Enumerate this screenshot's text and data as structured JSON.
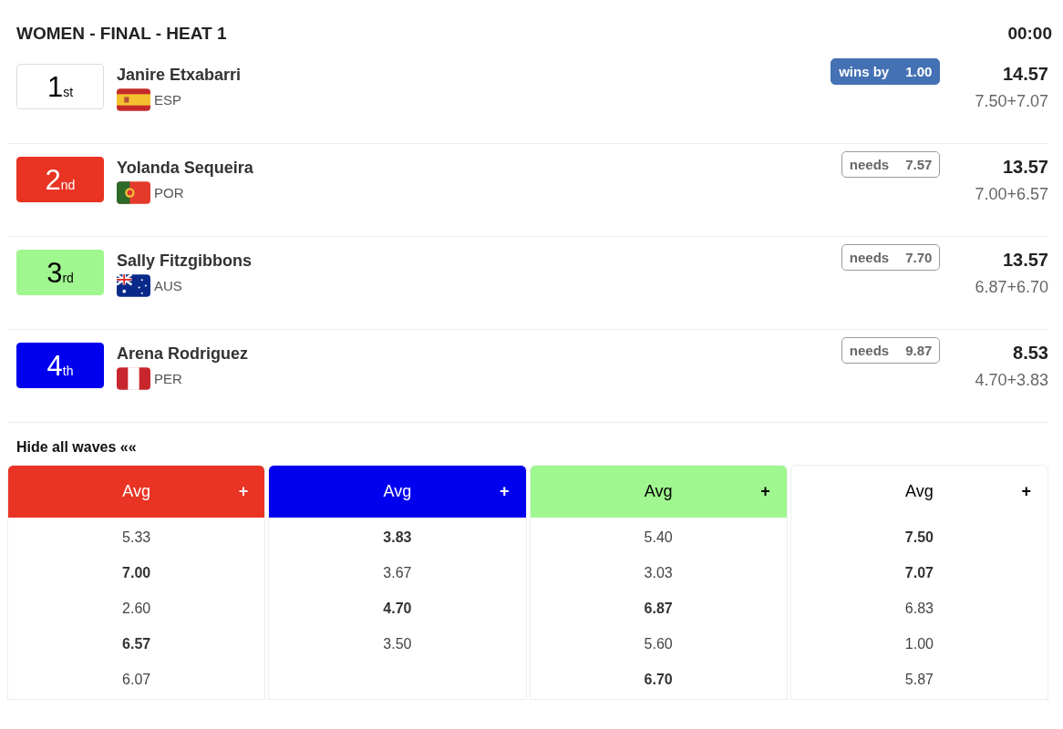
{
  "heat": {
    "title": "WOMEN - FINAL - HEAT 1",
    "clock": "00:00"
  },
  "surfers": [
    {
      "rank": "1",
      "suffix": "st",
      "color": "#ffffff",
      "name": "Janire Etxabarri",
      "flag": {
        "kind": "esp"
      },
      "country": "ESP",
      "status": {
        "kind": "wins",
        "label": "wins by",
        "value": "1.00"
      },
      "total": "14.57",
      "breakdown": "7.50+7.07"
    },
    {
      "rank": "2",
      "suffix": "nd",
      "color": "#e93323",
      "name": "Yolanda Sequeira",
      "flag": {
        "kind": "por"
      },
      "country": "POR",
      "status": {
        "kind": "needs",
        "label": "needs",
        "value": "7.57"
      },
      "total": "13.57",
      "breakdown": "7.00+6.57"
    },
    {
      "rank": "3",
      "suffix": "rd",
      "color": "#a0f78f",
      "name": "Sally Fitzgibbons",
      "flag": {
        "kind": "aus"
      },
      "country": "AUS",
      "status": {
        "kind": "needs",
        "label": "needs",
        "value": "7.70"
      },
      "total": "13.57",
      "breakdown": "6.87+6.70"
    },
    {
      "rank": "4",
      "suffix": "th",
      "color": "#0000ee",
      "name": "Arena Rodriguez",
      "flag": {
        "kind": "per"
      },
      "country": "PER",
      "status": {
        "kind": "needs",
        "label": "needs",
        "value": "9.87"
      },
      "total": "8.53",
      "breakdown": "4.70+3.83"
    }
  ],
  "waves_toggle": "Hide all waves ««",
  "wave_columns": [
    {
      "color": "#e93323",
      "header": "Avg",
      "expand": "+",
      "waves": [
        {
          "score": "5.33",
          "counted": false
        },
        {
          "score": "7.00",
          "counted": true
        },
        {
          "score": "2.60",
          "counted": false
        },
        {
          "score": "6.57",
          "counted": true
        },
        {
          "score": "6.07",
          "counted": false
        }
      ]
    },
    {
      "color": "#0000ee",
      "header": "Avg",
      "expand": "+",
      "waves": [
        {
          "score": "3.83",
          "counted": true
        },
        {
          "score": "3.67",
          "counted": false
        },
        {
          "score": "4.70",
          "counted": true
        },
        {
          "score": "3.50",
          "counted": false
        }
      ]
    },
    {
      "color": "#a0f78f",
      "header": "Avg",
      "expand": "+",
      "waves": [
        {
          "score": "5.40",
          "counted": false
        },
        {
          "score": "3.03",
          "counted": false
        },
        {
          "score": "6.87",
          "counted": true
        },
        {
          "score": "5.60",
          "counted": false
        },
        {
          "score": "6.70",
          "counted": true
        }
      ]
    },
    {
      "color": "#ffffff",
      "header": "Avg",
      "expand": "+",
      "waves": [
        {
          "score": "7.50",
          "counted": true
        },
        {
          "score": "7.07",
          "counted": true
        },
        {
          "score": "6.83",
          "counted": false
        },
        {
          "score": "1.00",
          "counted": false
        },
        {
          "score": "5.87",
          "counted": false
        }
      ]
    }
  ]
}
